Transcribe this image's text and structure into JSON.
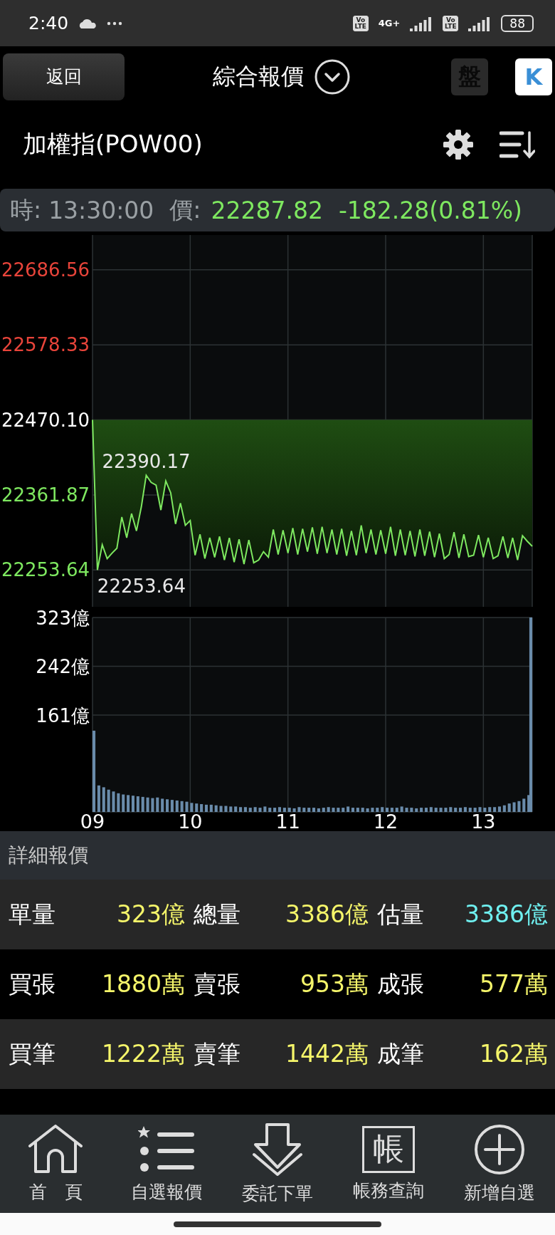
{
  "status_bar": {
    "time": "2:40",
    "sim_badges": [
      "Vo LTE",
      "Vo LTE"
    ],
    "network": "4G+",
    "battery": "88"
  },
  "header": {
    "back_button": "返回",
    "title": "綜合報價",
    "buttons": [
      {
        "kind": "dark",
        "label": "盤"
      },
      {
        "kind": "light",
        "label": "K"
      }
    ]
  },
  "symbol": {
    "name": "加權指(POW00)"
  },
  "quote": {
    "time_label": "時:",
    "time": "13:30:00",
    "price_label": "價:",
    "price": "22287.82",
    "change": "-182.28",
    "percent": "(0.81%)"
  },
  "price_chart": {
    "chart_data": {
      "type": "line",
      "grid": true,
      "xlim": [
        9,
        13.5
      ],
      "ylim": [
        22200.5,
        22736.7
      ],
      "yticks": [
        {
          "value": 22686.56,
          "label": "22686.56"
        },
        {
          "value": 22578.33,
          "label": "22578.33"
        },
        {
          "value": 22470.1,
          "label": "22470.10"
        },
        {
          "value": 22361.87,
          "label": "22361.87"
        },
        {
          "value": 22253.64,
          "label": "22253.64"
        }
      ],
      "x": [
        9,
        9.05,
        9.1,
        9.15,
        9.2,
        9.25,
        9.3,
        9.35,
        9.4,
        9.45,
        9.5,
        9.55,
        9.6,
        9.65,
        9.7,
        9.75,
        9.8,
        9.85,
        9.9,
        9.95,
        10,
        10.05,
        10.1,
        10.15,
        10.2,
        10.25,
        10.3,
        10.35,
        10.4,
        10.45,
        10.5,
        10.55,
        10.6,
        10.65,
        10.7,
        10.75,
        10.8,
        10.85,
        10.9,
        10.95,
        11,
        11.05,
        11.1,
        11.15,
        11.2,
        11.25,
        11.3,
        11.35,
        11.4,
        11.45,
        11.5,
        11.55,
        11.6,
        11.65,
        11.7,
        11.75,
        11.8,
        11.85,
        11.9,
        11.95,
        12,
        12.05,
        12.1,
        12.15,
        12.2,
        12.25,
        12.3,
        12.35,
        12.4,
        12.45,
        12.5,
        12.55,
        12.6,
        12.65,
        12.7,
        12.75,
        12.8,
        12.85,
        12.9,
        12.95,
        13,
        13.05,
        13.1,
        13.15,
        13.2,
        13.25,
        13.3,
        13.35,
        13.4,
        13.45,
        13.5
      ],
      "series": [
        {
          "color": "#7ee860",
          "values": [
            22470.1,
            22253.64,
            22290,
            22270,
            22278,
            22285,
            22330,
            22300,
            22335,
            22310,
            22345,
            22390.17,
            22380,
            22376,
            22340,
            22382,
            22365,
            22320,
            22350,
            22318,
            22325,
            22275,
            22305,
            22270,
            22300,
            22272,
            22302,
            22268,
            22300,
            22265,
            22298,
            22262,
            22297,
            22264,
            22268,
            22280,
            22272,
            22312,
            22276,
            22311,
            22278,
            22314,
            22276,
            22313,
            22280,
            22315,
            22277,
            22316,
            22278,
            22312,
            22276,
            22313,
            22274,
            22310,
            22275,
            22318,
            22278,
            22312,
            22276,
            22311,
            22277,
            22316,
            22274,
            22312,
            22275,
            22310,
            22273,
            22312,
            22274,
            22309,
            22272,
            22306,
            22270,
            22276,
            22308,
            22271,
            22305,
            22273,
            22275,
            22304,
            22272,
            22300,
            22270,
            22274,
            22302,
            22271,
            22300,
            22268,
            22303,
            22295,
            22287.82
          ]
        }
      ],
      "annotations": [
        {
          "x": 9.55,
          "y": 22390.17,
          "text": "22390.17"
        },
        {
          "x": 9.05,
          "y": 22253.64,
          "text": "22253.64"
        }
      ]
    }
  },
  "volume_chart": {
    "chart_data": {
      "type": "bar",
      "grid": true,
      "xlim": [
        9,
        13.5
      ],
      "ylim": [
        0,
        323
      ],
      "xticks": [
        {
          "value": 9,
          "label": "09"
        },
        {
          "value": 10,
          "label": "10"
        },
        {
          "value": 11,
          "label": "11"
        },
        {
          "value": 12,
          "label": "12"
        },
        {
          "value": 13,
          "label": "13"
        }
      ],
      "yticks": [
        {
          "value": 323,
          "label": "323億"
        },
        {
          "value": 242,
          "label": "242億"
        },
        {
          "value": 161,
          "label": "161億"
        }
      ],
      "x": [
        9,
        9.05,
        9.1,
        9.15,
        9.2,
        9.25,
        9.3,
        9.35,
        9.4,
        9.45,
        9.5,
        9.55,
        9.6,
        9.65,
        9.7,
        9.75,
        9.8,
        9.85,
        9.9,
        9.95,
        10,
        10.05,
        10.1,
        10.15,
        10.2,
        10.25,
        10.3,
        10.35,
        10.4,
        10.45,
        10.5,
        10.55,
        10.6,
        10.65,
        10.7,
        10.75,
        10.8,
        10.85,
        10.9,
        10.95,
        11,
        11.05,
        11.1,
        11.15,
        11.2,
        11.25,
        11.3,
        11.35,
        11.4,
        11.45,
        11.5,
        11.55,
        11.6,
        11.65,
        11.7,
        11.75,
        11.8,
        11.85,
        11.9,
        11.95,
        12,
        12.05,
        12.1,
        12.15,
        12.2,
        12.25,
        12.3,
        12.35,
        12.4,
        12.45,
        12.5,
        12.55,
        12.6,
        12.65,
        12.7,
        12.75,
        12.8,
        12.85,
        12.9,
        12.95,
        13,
        13.05,
        13.1,
        13.15,
        13.2,
        13.25,
        13.3,
        13.35,
        13.4,
        13.45,
        13.5
      ],
      "series": [
        {
          "color": "#6a8cab",
          "values": [
            135,
            44,
            41,
            37,
            34,
            31,
            29,
            28,
            27,
            26,
            25,
            24,
            23,
            24,
            22,
            21,
            20,
            19,
            18,
            17,
            15,
            14,
            13,
            12,
            12,
            11,
            10,
            10,
            9,
            9,
            8,
            8,
            7,
            8,
            7,
            9,
            7,
            7,
            8,
            7,
            7,
            6,
            8,
            7,
            7,
            7,
            6,
            7,
            8,
            7,
            7,
            7,
            9,
            7,
            7,
            7,
            6,
            7,
            7,
            8,
            7,
            7,
            7,
            9,
            7,
            7,
            6,
            7,
            7,
            8,
            7,
            7,
            7,
            8,
            7,
            7,
            8,
            7,
            7,
            8,
            7,
            8,
            8,
            9,
            11,
            14,
            16,
            18,
            22,
            28,
            323
          ]
        }
      ]
    }
  },
  "detail": {
    "title": "詳細報價",
    "rows": [
      [
        {
          "label": "單量",
          "value": "323億",
          "color": "#f5f56a"
        },
        {
          "label": "總量",
          "value": "3386億",
          "color": "#f5f56a"
        },
        {
          "label": "估量",
          "value": "3386億",
          "color": "#6ff0f0"
        }
      ],
      [
        {
          "label": "買張",
          "value": "1880萬",
          "color": "#f5f56a"
        },
        {
          "label": "賣張",
          "value": "953萬",
          "color": "#f5f56a"
        },
        {
          "label": "成張",
          "value": "577萬",
          "color": "#f5f56a"
        }
      ],
      [
        {
          "label": "買筆",
          "value": "1222萬",
          "color": "#f5f56a"
        },
        {
          "label": "賣筆",
          "value": "1442萬",
          "color": "#f5f56a"
        },
        {
          "label": "成筆",
          "value": "162萬",
          "color": "#f5f56a"
        }
      ]
    ]
  },
  "nav": [
    {
      "kind": "home",
      "label": "首　頁"
    },
    {
      "kind": "list",
      "label": "自選報價"
    },
    {
      "kind": "order",
      "label": "委託下單"
    },
    {
      "kind": "account",
      "label": "帳務查詢",
      "icon_text": "帳"
    },
    {
      "kind": "add",
      "label": "新增自選"
    }
  ]
}
